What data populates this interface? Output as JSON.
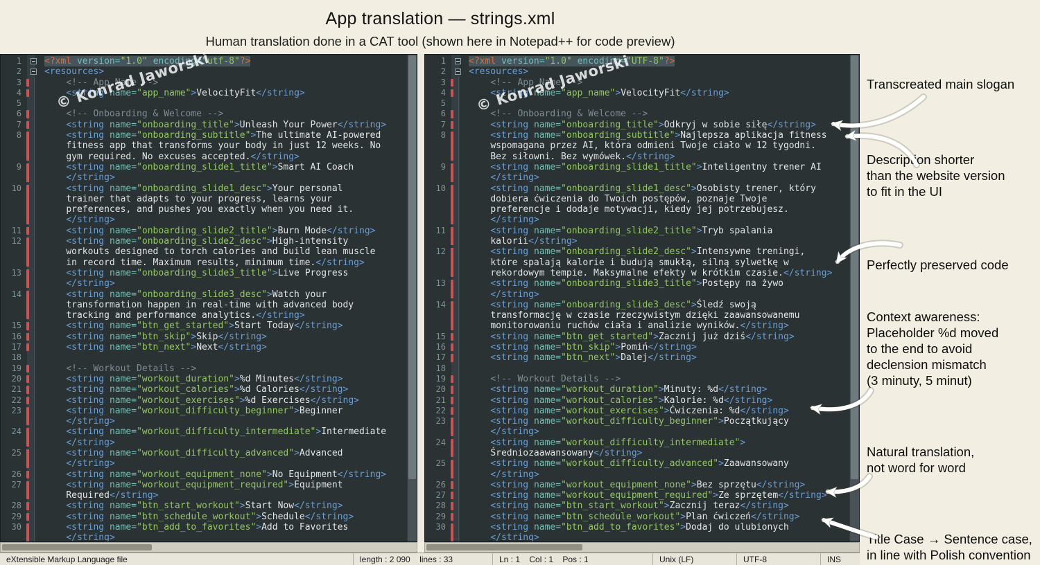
{
  "header": {
    "title": "App translation — strings.xml",
    "subtitle": "Human translation done in a CAT tool (shown here in Notepad++ for code preview)"
  },
  "watermark": "© Konrad Jaworski",
  "colors": {
    "tag": "#6A9FD4",
    "attribute": "#6FC0B5",
    "value": "#93C763",
    "text": "#E2E4E5",
    "comment": "#7E8C93",
    "prolog": "#D8703C",
    "change_marker": "#C85454",
    "editor_background": "#2B3234",
    "selection_band": "#46545C"
  },
  "panes": {
    "left": {
      "lines": [
        {
          "n": 1,
          "t": "<?xml version=\"1.0\" encoding=\"utf-8\"?>",
          "hl": true,
          "fold": true
        },
        {
          "n": 2,
          "t": "<resources>",
          "fold": true
        },
        {
          "n": 3,
          "t": "    <!-- App Name -->",
          "m": true
        },
        {
          "n": 4,
          "t": "    <string name=\"app_name\">VelocityFit</string>",
          "m": true
        },
        {
          "n": 5,
          "t": ""
        },
        {
          "n": 6,
          "t": "    <!-- Onboarding & Welcome -->",
          "m": true
        },
        {
          "n": 7,
          "t": "    <string name=\"onboarding_title\">Unleash Your Power</string>",
          "m": true
        },
        {
          "n": 8,
          "t": "    <string name=\"onboarding_subtitle\">The ultimate AI-powered\nfitness app that transforms your body in just 12 weeks. No\ngym required. No excuses accepted.</string>",
          "m": true
        },
        {
          "n": 9,
          "t": "    <string name=\"onboarding_slide1_title\">Smart AI Coach\n</string>",
          "m": true
        },
        {
          "n": 10,
          "t": "    <string name=\"onboarding_slide1_desc\">Your personal\ntrainer that adapts to your progress, learns your\npreferences, and pushes you exactly when you need it.\n</string>",
          "m": true
        },
        {
          "n": 11,
          "t": "    <string name=\"onboarding_slide2_title\">Burn Mode</string>",
          "m": true
        },
        {
          "n": 12,
          "t": "    <string name=\"onboarding_slide2_desc\">High-intensity\nworkouts designed to torch calories and build lean muscle\nin record time. Maximum results, minimum time.</string>",
          "m": true
        },
        {
          "n": 13,
          "t": "    <string name=\"onboarding_slide3_title\">Live Progress\n</string>",
          "m": true
        },
        {
          "n": 14,
          "t": "    <string name=\"onboarding_slide3_desc\">Watch your\ntransformation happen in real-time with advanced body\ntracking and performance analytics.</string>",
          "m": true
        },
        {
          "n": 15,
          "t": "    <string name=\"btn_get_started\">Start Today</string>",
          "m": true
        },
        {
          "n": 16,
          "t": "    <string name=\"btn_skip\">Skip</string>",
          "m": true
        },
        {
          "n": 17,
          "t": "    <string name=\"btn_next\">Next</string>",
          "m": true
        },
        {
          "n": 18,
          "t": ""
        },
        {
          "n": 19,
          "t": "    <!-- Workout Details -->",
          "m": true
        },
        {
          "n": 20,
          "t": "    <string name=\"workout_duration\">%d Minutes</string>",
          "m": true
        },
        {
          "n": 21,
          "t": "    <string name=\"workout_calories\">%d Calories</string>",
          "m": true
        },
        {
          "n": 22,
          "t": "    <string name=\"workout_exercises\">%d Exercises</string>",
          "m": true
        },
        {
          "n": 23,
          "t": "    <string name=\"workout_difficulty_beginner\">Beginner\n</string>",
          "m": true
        },
        {
          "n": 24,
          "t": "    <string name=\"workout_difficulty_intermediate\">Intermediate\n</string>",
          "m": true
        },
        {
          "n": 25,
          "t": "    <string name=\"workout_difficulty_advanced\">Advanced\n</string>",
          "m": true
        },
        {
          "n": 26,
          "t": "    <string name=\"workout_equipment_none\">No Equipment</string>",
          "m": true
        },
        {
          "n": 27,
          "t": "    <string name=\"workout_equipment_required\">Equipment\nRequired</string>",
          "m": true
        },
        {
          "n": 28,
          "t": "    <string name=\"btn_start_workout\">Start Now</string>",
          "m": true
        },
        {
          "n": 29,
          "t": "    <string name=\"btn_schedule_workout\">Schedule</string>",
          "m": true
        },
        {
          "n": 30,
          "t": "    <string name=\"btn_add_to_favorites\">Add to Favorites\n</string>",
          "m": true
        }
      ]
    },
    "right": {
      "lines": [
        {
          "n": 1,
          "t": "<?xml version=\"1.0\" encoding=\"UTF-8\"?>",
          "hl": true,
          "fold": true
        },
        {
          "n": 2,
          "t": "<resources>",
          "fold": true
        },
        {
          "n": 3,
          "t": "    <!-- App Name -->",
          "m": true
        },
        {
          "n": 4,
          "t": "    <string name=\"app_name\">VelocityFit</string>",
          "m": true
        },
        {
          "n": 5,
          "t": ""
        },
        {
          "n": 6,
          "t": "    <!-- Onboarding & Welcome -->",
          "m": true
        },
        {
          "n": 7,
          "t": "    <string name=\"onboarding_title\">Odkryj w sobie siłę</string>",
          "m": true
        },
        {
          "n": 8,
          "t": "    <string name=\"onboarding_subtitle\">Najlepsza aplikacja fitness\nwspomagana przez AI, która odmieni Twoje ciało w 12 tygodni.\nBez siłowni. Bez wymówek.</string>",
          "m": true
        },
        {
          "n": 9,
          "t": "    <string name=\"onboarding_slide1_title\">Inteligentny trener AI\n</string>",
          "m": true
        },
        {
          "n": 10,
          "t": "    <string name=\"onboarding_slide1_desc\">Osobisty trener, który\ndobiera ćwiczenia do Twoich postępów, poznaje Twoje\npreferencje i dodaje motywacji, kiedy jej potrzebujesz.\n</string>",
          "m": true
        },
        {
          "n": 11,
          "t": "    <string name=\"onboarding_slide2_title\">Tryb spalania kalorii</string>",
          "m": true
        },
        {
          "n": 12,
          "t": "    <string name=\"onboarding_slide2_desc\">Intensywne treningi,\nktóre spalają kalorie i budują smukłą, silną sylwetkę w\nrekordowym tempie. Maksymalne efekty w krótkim czasie.</string>",
          "m": true
        },
        {
          "n": 13,
          "t": "    <string name=\"onboarding_slide3_title\">Postępy na żywo\n</string>",
          "m": true
        },
        {
          "n": 14,
          "t": "    <string name=\"onboarding_slide3_desc\">Śledź swoją\ntransformację w czasie rzeczywistym dzięki zaawansowanemu\nmonitorowaniu ruchów ciała i analizie wyników.</string>",
          "m": true
        },
        {
          "n": 15,
          "t": "    <string name=\"btn_get_started\">Zacznij już dziś</string>",
          "m": true
        },
        {
          "n": 16,
          "t": "    <string name=\"btn_skip\">Pomiń</string>",
          "m": true
        },
        {
          "n": 17,
          "t": "    <string name=\"btn_next\">Dalej</string>",
          "m": true
        },
        {
          "n": 18,
          "t": ""
        },
        {
          "n": 19,
          "t": "    <!-- Workout Details -->",
          "m": true
        },
        {
          "n": 20,
          "t": "    <string name=\"workout_duration\">Minuty: %d</string>",
          "m": true
        },
        {
          "n": 21,
          "t": "    <string name=\"workout_calories\">Kalorie: %d</string>",
          "m": true
        },
        {
          "n": 22,
          "t": "    <string name=\"workout_exercises\">Ćwiczenia: %d</string>",
          "m": true
        },
        {
          "n": 23,
          "t": "    <string name=\"workout_difficulty_beginner\">Początkujący\n</string>",
          "m": true
        },
        {
          "n": 24,
          "t": "    <string name=\"workout_difficulty_intermediate\">\nŚredniozaawansowany</string>",
          "m": true
        },
        {
          "n": 25,
          "t": "    <string name=\"workout_difficulty_advanced\">Zaawansowany\n</string>",
          "m": true
        },
        {
          "n": 26,
          "t": "    <string name=\"workout_equipment_none\">Bez sprzętu</string>",
          "m": true
        },
        {
          "n": 27,
          "t": "    <string name=\"workout_equipment_required\">Ze sprzętem</string>",
          "m": true
        },
        {
          "n": 28,
          "t": "    <string name=\"btn_start_workout\">Zacznij teraz</string>",
          "m": true
        },
        {
          "n": 29,
          "t": "    <string name=\"btn_schedule_workout\">Plan ćwiczeń</string>",
          "m": true
        },
        {
          "n": 30,
          "t": "    <string name=\"btn_add_to_favorites\">Dodaj do ulubionych\n</string>",
          "m": true
        },
        {
          "n": 31,
          "t": ""
        }
      ]
    }
  },
  "annotations": [
    {
      "text": "Transcreated main slogan"
    },
    {
      "text": "Description shorter\nthan the website version\nto fit in the UI"
    },
    {
      "text": "Perfectly preserved code"
    },
    {
      "text": "Context awareness:\nPlaceholder %d moved\nto the end to avoid\ndeclension mismatch\n(3 minuty, 5 minut)"
    },
    {
      "text": "Natural translation,\nnot word for word"
    },
    {
      "text": "Title Case → Sentence case,\nin line with Polish convention"
    }
  ],
  "status_bar": {
    "file_type": "eXtensible Markup Language file",
    "length_lines": "length : 2 090    lines : 33",
    "caret": "Ln : 1    Col : 1    Pos : 1",
    "eol": "Unix (LF)",
    "encoding": "UTF-8",
    "insert_mode": "INS"
  }
}
